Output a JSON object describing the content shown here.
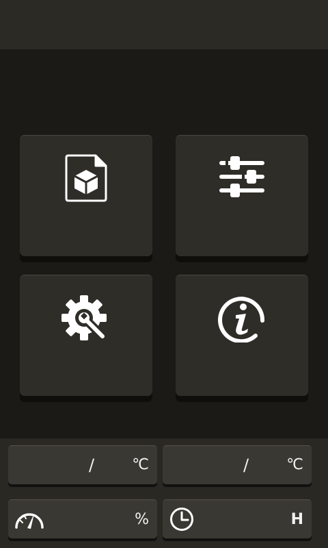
{
  "menu": {
    "tiles": [
      {
        "icon": "model-file-icon"
      },
      {
        "icon": "sliders-icon"
      },
      {
        "icon": "gear-wrench-icon"
      },
      {
        "icon": "info-icon"
      }
    ]
  },
  "status": {
    "temp1": {
      "separator": "/",
      "unit": "℃"
    },
    "temp2": {
      "separator": "/",
      "unit": "℃"
    },
    "fan": {
      "icon": "speedometer-icon",
      "unit": "%"
    },
    "timer": {
      "icon": "clock-icon",
      "unit": "H"
    }
  }
}
